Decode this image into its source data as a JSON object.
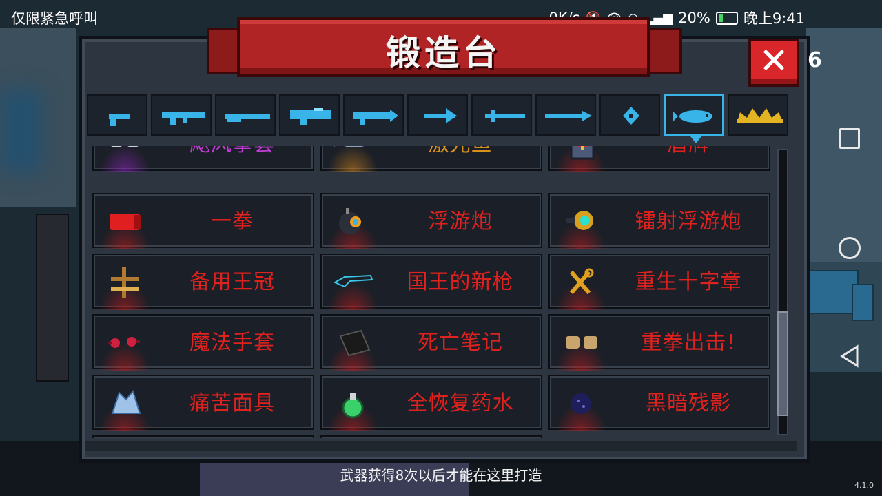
{
  "status_bar": {
    "carrier_text": "仅限紧急呼叫",
    "net_speed": "0K/s",
    "battery": "20%",
    "time": "晚上9:41"
  },
  "title": "锻造台",
  "close_label": "✕",
  "side_count": "6",
  "tabs": [
    {
      "icon": "pistol-icon",
      "active": false
    },
    {
      "icon": "assault-rifle-icon",
      "active": false
    },
    {
      "icon": "shotgun-icon",
      "active": false
    },
    {
      "icon": "laser-rifle-icon",
      "active": false
    },
    {
      "icon": "energy-gun-icon",
      "active": false
    },
    {
      "icon": "crossbow-icon",
      "active": false
    },
    {
      "icon": "sword-icon",
      "active": false
    },
    {
      "icon": "spear-icon",
      "active": false
    },
    {
      "icon": "staff-icon",
      "active": false
    },
    {
      "icon": "fish-icon",
      "active": true
    },
    {
      "icon": "crown-icon",
      "active": false
    }
  ],
  "items": [
    {
      "label": "飓风拳套",
      "icon": "tornado-gloves-icon",
      "color": "#c23cd6"
    },
    {
      "label": "激光鱼",
      "icon": "laser-fish-icon",
      "color": "#d8911f"
    },
    {
      "label": "盾牌",
      "icon": "shield-icon",
      "color": "#e0221f"
    },
    {
      "label": "一拳",
      "icon": "red-fist-icon",
      "color": "#e0221f"
    },
    {
      "label": "浮游炮",
      "icon": "floating-cannon-icon",
      "color": "#e0221f"
    },
    {
      "label": "镭射浮游炮",
      "icon": "laser-floating-cannon-icon",
      "color": "#e0221f"
    },
    {
      "label": "备用王冠",
      "icon": "spare-crown-icon",
      "color": "#e0221f"
    },
    {
      "label": "国王的新枪",
      "icon": "invisible-gun-icon",
      "color": "#e0221f"
    },
    {
      "label": "重生十字章",
      "icon": "rebirth-cross-icon",
      "color": "#e0221f"
    },
    {
      "label": "魔法手套",
      "icon": "magic-gloves-icon",
      "color": "#e0221f"
    },
    {
      "label": "死亡笔记",
      "icon": "death-note-icon",
      "color": "#e0221f"
    },
    {
      "label": "重拳出击!",
      "icon": "heavy-punch-icon",
      "color": "#e0221f"
    },
    {
      "label": "痛苦面具",
      "icon": "pain-mask-icon",
      "color": "#e0221f"
    },
    {
      "label": "全恢复药水",
      "icon": "full-potion-icon",
      "color": "#e0221f"
    },
    {
      "label": "黑暗残影",
      "icon": "dark-shadow-icon",
      "color": "#e0221f"
    }
  ],
  "footer_message": "武器获得8次以后才能在这里打造",
  "version": "4.1.0"
}
